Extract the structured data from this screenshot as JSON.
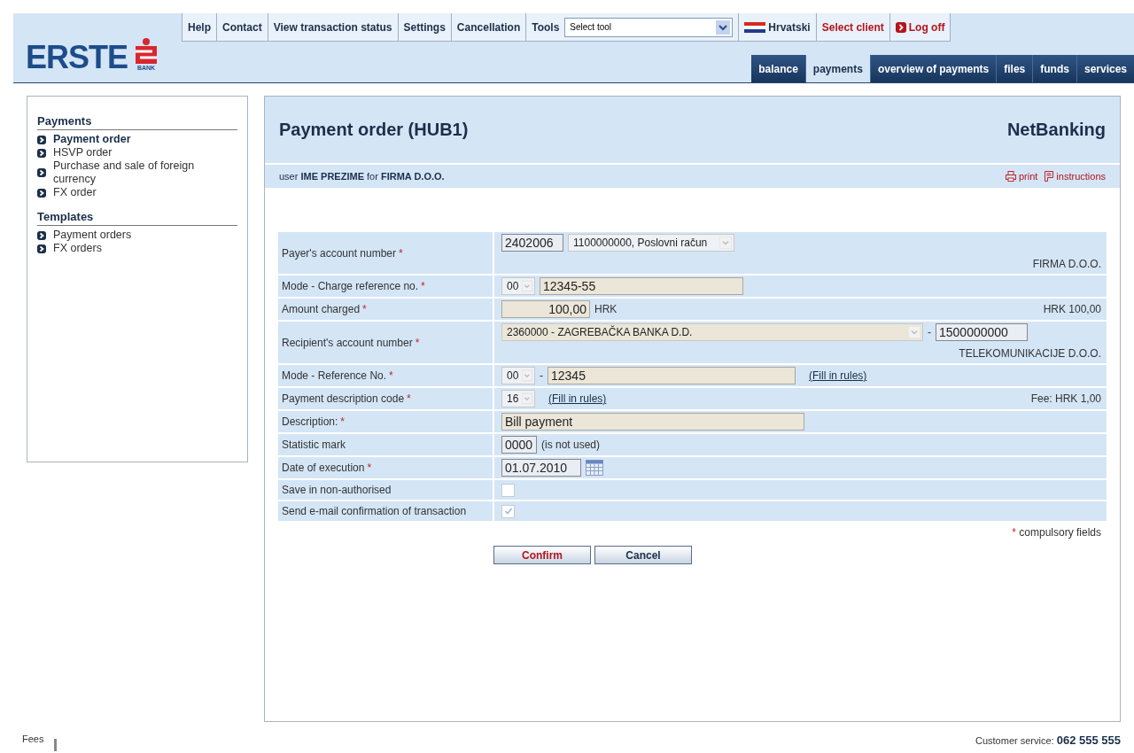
{
  "logo": {
    "name": "ERSTE",
    "sub": "BANK"
  },
  "top_bar": [
    {
      "kind": "link",
      "label": "Help"
    },
    {
      "kind": "link",
      "label": "Contact"
    },
    {
      "kind": "link",
      "label": "View transaction status"
    },
    {
      "kind": "link",
      "label": "Settings"
    },
    {
      "kind": "link",
      "label": "Cancellation"
    },
    {
      "kind": "tools",
      "label": "Tools",
      "value": "Select tool"
    },
    {
      "kind": "language",
      "label": "Hrvatski"
    },
    {
      "kind": "alert",
      "label": "Select client"
    },
    {
      "kind": "logoff",
      "label": "Log off"
    }
  ],
  "tabs": [
    {
      "label": "balance",
      "selected": false
    },
    {
      "label": "payments",
      "selected": true
    },
    {
      "label": "overview of payments",
      "selected": false
    },
    {
      "label": "files",
      "selected": false
    },
    {
      "label": "funds",
      "selected": false
    },
    {
      "label": "services",
      "selected": false
    }
  ],
  "sidebar": [
    {
      "title": "Payments",
      "items": [
        {
          "label": "Payment order",
          "selected": true
        },
        {
          "label": "HSVP order",
          "selected": false
        },
        {
          "label": "Purchase and sale of foreign currency",
          "selected": false
        },
        {
          "label": "FX order",
          "selected": false
        }
      ]
    },
    {
      "title": "Templates",
      "items": [
        {
          "label": "Payment orders",
          "selected": false
        },
        {
          "label": "FX orders",
          "selected": false
        }
      ]
    }
  ],
  "panel": {
    "title": "Payment order (HUB1)",
    "brand": "NetBanking",
    "user_line": "user **IME PREZIME** for **FIRMA D.O.O.**",
    "actions": [
      {
        "kind": "print",
        "label": "print"
      },
      {
        "kind": "instructions",
        "label": "instructions"
      }
    ]
  },
  "form": [
    {
      "label": "Payer's account number",
      "required": true,
      "controls": [
        {
          "kind": "code_field",
          "value": "2402006"
        },
        {
          "kind": "select",
          "value": "1100000000, Poslovni račun"
        }
      ],
      "note": "FIRMA D.O.O.",
      "note_below": true
    },
    {
      "label": "Mode - Charge reference no.",
      "required": true,
      "controls": [
        {
          "kind": "small_select",
          "value": "00"
        },
        {
          "kind": "field",
          "value": "12345-55"
        }
      ]
    },
    {
      "label": "Amount charged",
      "required": true,
      "controls": [
        {
          "kind": "amount_field",
          "value": "100,00"
        },
        {
          "kind": "text",
          "value": "HRK"
        }
      ],
      "note": "HRK 100,00",
      "note_below": false
    },
    {
      "label": "Recipient's account number",
      "required": true,
      "controls": [
        {
          "kind": "wide_select",
          "value": "2360000 - ZAGREBAČKA BANKA D.D."
        },
        {
          "kind": "text",
          "value": "-"
        },
        {
          "kind": "code_field",
          "value": "1500000000"
        }
      ],
      "note": "TELEKOMUNIKACIJE D.O.O.",
      "note_below": true
    },
    {
      "label": "Mode - Reference No.",
      "required": true,
      "controls": [
        {
          "kind": "small_select",
          "value": "00"
        },
        {
          "kind": "text",
          "value": "-"
        },
        {
          "kind": "field",
          "value": "12345"
        },
        {
          "kind": "link",
          "value": "(Fill in rules)"
        }
      ]
    },
    {
      "label": "Payment description code",
      "required": true,
      "controls": [
        {
          "kind": "small_select",
          "value": "16"
        },
        {
          "kind": "link",
          "value": "(Fill in rules)"
        }
      ],
      "note": "Fee: HRK 1,00",
      "note_below": false
    },
    {
      "label": "Description:",
      "required": true,
      "controls": [
        {
          "kind": "long_field",
          "value": "Bill payment"
        }
      ]
    },
    {
      "label": "Statistic mark",
      "required": false,
      "controls": [
        {
          "kind": "code_field",
          "value": "0000"
        },
        {
          "kind": "text",
          "value": "(is not used)"
        }
      ]
    },
    {
      "label": "Date of execution",
      "required": true,
      "controls": [
        {
          "kind": "code_field",
          "value": "01.07.2010"
        },
        {
          "kind": "calendar"
        }
      ]
    },
    {
      "label": "Save in non-authorised",
      "required": false,
      "controls": [
        {
          "kind": "checkbox",
          "checked": false,
          "disabled": true
        }
      ]
    },
    {
      "label": "Send e-mail confirmation of transaction",
      "required": false,
      "controls": [
        {
          "kind": "checkbox",
          "checked": true,
          "disabled": true
        }
      ]
    }
  ],
  "required_note": {
    "mark": "*",
    "text": "compulsory fields"
  },
  "buttons": [
    {
      "kind": "primary",
      "label": "Confirm"
    },
    {
      "kind": "secondary",
      "label": "Cancel"
    }
  ],
  "footer": {
    "fees": "Fees",
    "service": "Customer service: **062 555 555**"
  }
}
